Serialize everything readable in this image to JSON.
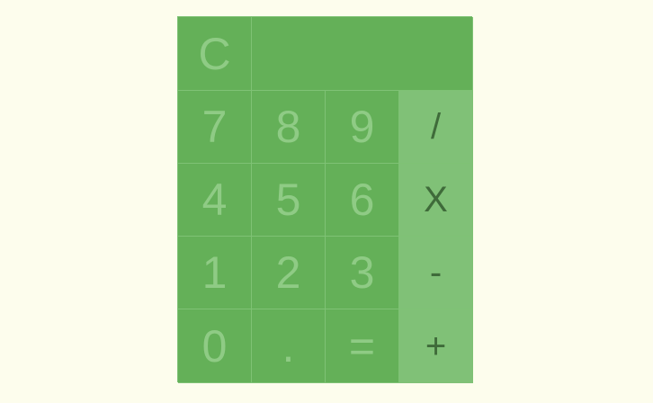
{
  "display": {
    "value": ""
  },
  "keys": {
    "clear": "C",
    "seven": "7",
    "eight": "8",
    "nine": "9",
    "divide": "/",
    "four": "4",
    "five": "5",
    "six": "6",
    "multiply": "X",
    "one": "1",
    "two": "2",
    "three": "3",
    "subtract": "-",
    "zero": "0",
    "decimal": ".",
    "equals": "=",
    "add": "+"
  },
  "colors": {
    "background": "#fdfded",
    "key_green": "#64b058",
    "operator_green": "#80c177",
    "key_text": "#8fcb85",
    "operator_text": "#3f6b3a"
  }
}
